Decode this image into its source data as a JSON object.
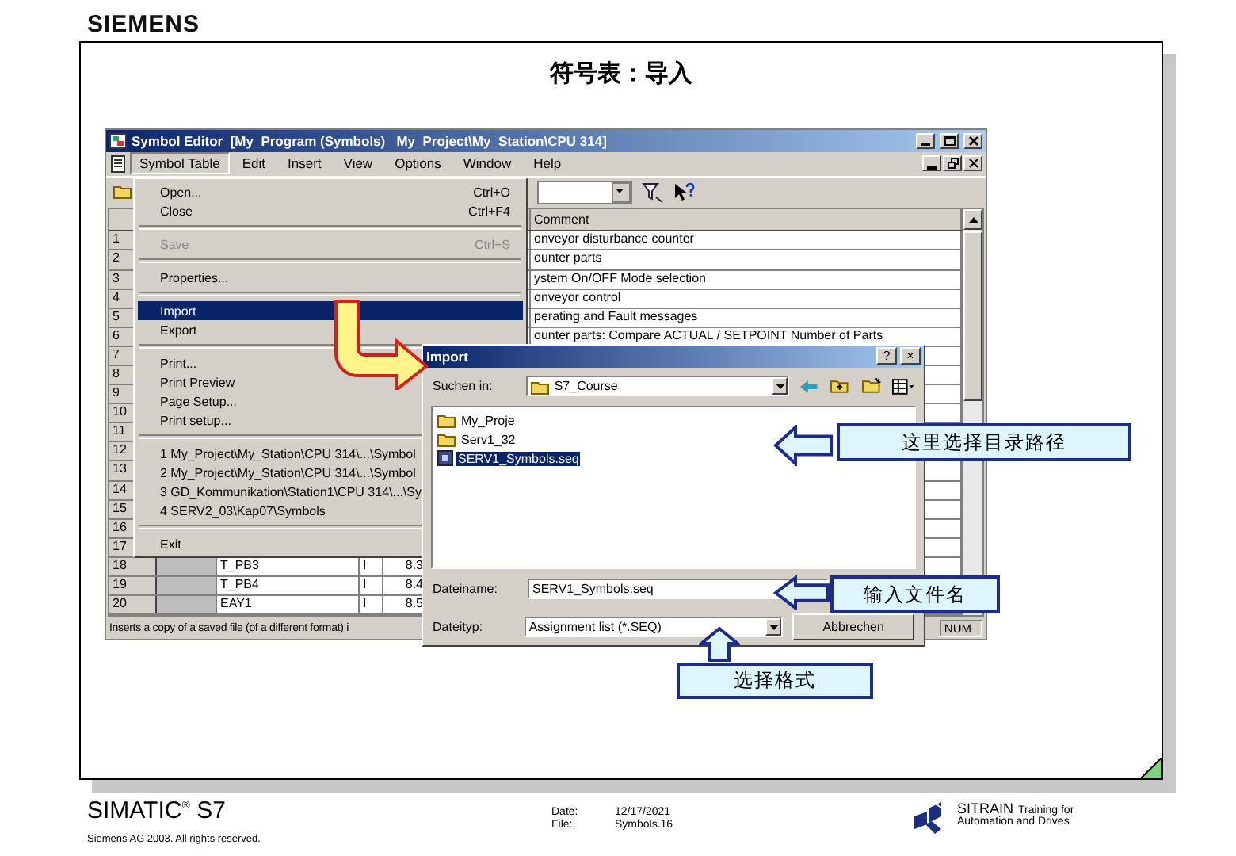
{
  "header": {
    "logo": "SIEMENS"
  },
  "slide": {
    "title": "符号表：导入"
  },
  "app_window": {
    "title": "Symbol Editor  [My_Program (Symbols)   My_Project\\My_Station\\CPU 314]",
    "menu_bar": [
      {
        "label": "Symbol Table",
        "selected": true
      },
      {
        "label": "Edit",
        "selected": false
      },
      {
        "label": "Insert",
        "selected": false
      },
      {
        "label": "View",
        "selected": false
      },
      {
        "label": "Options",
        "selected": false
      },
      {
        "label": "Window",
        "selected": false
      },
      {
        "label": "Help",
        "selected": false
      }
    ],
    "table": {
      "columns": [
        "Comment"
      ],
      "rows": [
        {
          "number": "1",
          "comment": "onveyor disturbance counter"
        },
        {
          "number": "2",
          "comment": "ounter parts"
        },
        {
          "number": "3",
          "comment": "ystem On/OFF Mode selection"
        },
        {
          "number": "4",
          "comment": "onveyor control"
        },
        {
          "number": "5",
          "comment": "perating and Fault messages"
        },
        {
          "number": "6",
          "comment": "ounter parts: Compare ACTUAL / SETPOINT Number of Parts"
        },
        {
          "number": "7"
        },
        {
          "number": "8"
        },
        {
          "number": "9"
        },
        {
          "number": "10"
        },
        {
          "number": "11"
        },
        {
          "number": "12"
        },
        {
          "number": "13"
        },
        {
          "number": "14"
        },
        {
          "number": "15"
        },
        {
          "number": "16"
        },
        {
          "number": "17"
        },
        {
          "number": "18",
          "symbol": "T_PB3",
          "address_type": "I",
          "address": "8.3"
        },
        {
          "number": "19",
          "symbol": "T_PB4",
          "address_type": "I",
          "address": "8.4"
        },
        {
          "number": "20",
          "symbol": "EAY1",
          "address_type": "I",
          "address": "8.5"
        }
      ]
    },
    "status_bar": {
      "message": "Inserts a copy of a saved file (of a different format) i",
      "indicator": "NUM"
    }
  },
  "menu": {
    "items": [
      {
        "kind": "item",
        "label": "Open...",
        "shortcut": "Ctrl+O",
        "disabled": false,
        "selected": false
      },
      {
        "kind": "item",
        "label": "Close",
        "shortcut": "Ctrl+F4",
        "disabled": false,
        "selected": false
      },
      {
        "kind": "separator"
      },
      {
        "kind": "item",
        "label": "Save",
        "shortcut": "Ctrl+S",
        "disabled": true,
        "selected": false
      },
      {
        "kind": "separator"
      },
      {
        "kind": "item",
        "label": "Properties...",
        "disabled": false,
        "selected": false
      },
      {
        "kind": "separator"
      },
      {
        "kind": "item",
        "label": "Import",
        "disabled": false,
        "selected": true
      },
      {
        "kind": "item",
        "label": "Export",
        "disabled": false,
        "selected": false
      },
      {
        "kind": "separator"
      },
      {
        "kind": "item",
        "label": "Print...",
        "disabled": false,
        "selected": false
      },
      {
        "kind": "item",
        "label": "Print Preview",
        "disabled": false,
        "selected": false
      },
      {
        "kind": "item",
        "label": "Page Setup...",
        "disabled": false,
        "selected": false
      },
      {
        "kind": "item",
        "label": "Print setup...",
        "disabled": false,
        "selected": false
      },
      {
        "kind": "separator"
      },
      {
        "kind": "item",
        "label": "1 My_Project\\My_Station\\CPU 314\\...\\Symbol",
        "disabled": false,
        "selected": false
      },
      {
        "kind": "item",
        "label": "2 My_Project\\My_Station\\CPU 314\\...\\Symbol",
        "disabled": false,
        "selected": false
      },
      {
        "kind": "item",
        "label": "3 GD_Kommunikation\\Station1\\CPU 314\\...\\Sy",
        "disabled": false,
        "selected": false
      },
      {
        "kind": "item",
        "label": "4 SERV2_03\\Kap07\\Symbols",
        "disabled": false,
        "selected": false
      },
      {
        "kind": "separator"
      },
      {
        "kind": "item",
        "label": "Exit",
        "disabled": false,
        "selected": false
      }
    ]
  },
  "dialog": {
    "title": "Import",
    "title_buttons": [
      "?",
      "×"
    ],
    "look_in": {
      "label": "Suchen in:",
      "value": "S7_Course"
    },
    "files": [
      {
        "name": "My_Proje",
        "kind": "folder",
        "selected": false
      },
      {
        "name": "Serv1_32",
        "kind": "folder",
        "selected": false
      },
      {
        "name": "SERV1_Symbols.seq",
        "kind": "file",
        "selected": true
      }
    ],
    "file_name": {
      "label": "Dateiname:",
      "value": "SERV1_Symbols.seq"
    },
    "file_type": {
      "label": "Dateityp:",
      "value": "Assignment list (*.SEQ)"
    },
    "buttons": [
      "Abbrechen"
    ]
  },
  "callouts": [
    {
      "text": "这里选择目录路径",
      "kind": "left"
    },
    {
      "text": "输入文件名",
      "kind": "left"
    },
    {
      "text": "选择格式",
      "kind": "up"
    }
  ],
  "footer": {
    "product": "SIMATIC$^{®}$ S7",
    "copyright": "Siemens AG 2003. All rights reserved.",
    "date_label": "Date:",
    "date": "12/17/2021",
    "file_label": "File:",
    "file": "Symbols.16",
    "brand": "SITRAIN",
    "brand_tagline": "Training for",
    "brand_line2": "Automation and Drives"
  }
}
